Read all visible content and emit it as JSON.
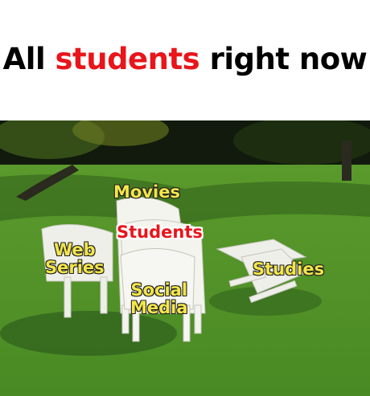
{
  "caption": {
    "before": "All ",
    "accent": "students",
    "after": " right now",
    "accent_color": "#e8151b"
  },
  "labels": {
    "movies": "Movies",
    "students": "Students",
    "web_series_line1": "Web",
    "web_series_line2": "Series",
    "social_media_line1": "Social",
    "social_media_line2": "Media",
    "studies": "Studies"
  },
  "colors": {
    "label_yellow": "#f3e64a",
    "grass": "#4f8f2a",
    "chair": "#f2f2ee"
  }
}
